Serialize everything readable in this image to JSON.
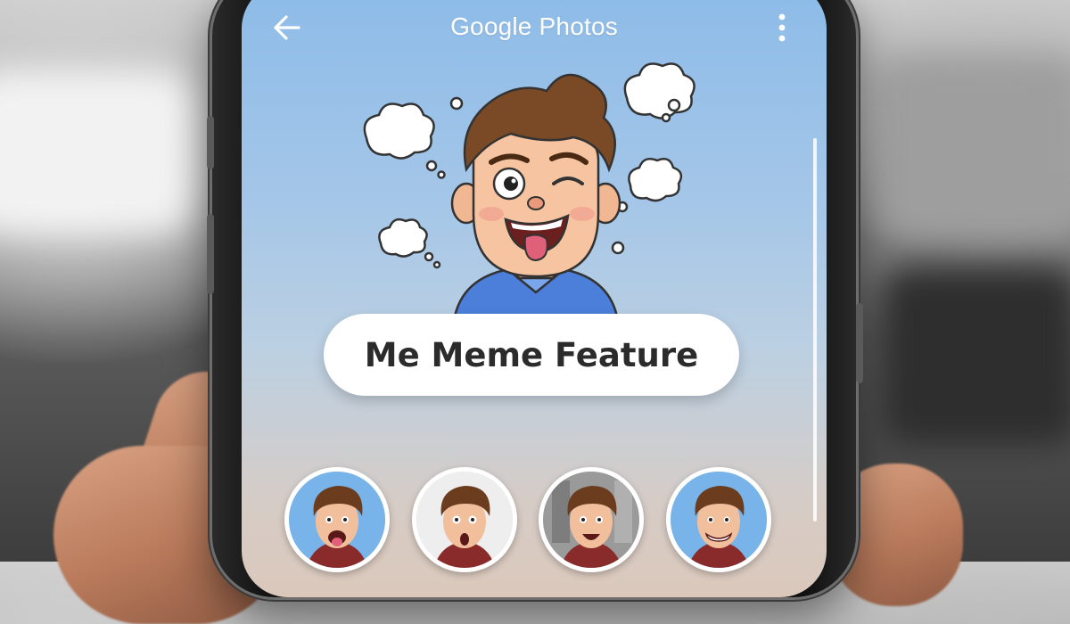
{
  "app": {
    "title": "Google Photos"
  },
  "header": {
    "back_icon": "arrow-left-icon",
    "menu_icon": "more-vert-icon"
  },
  "hero": {
    "feature_label": "Me Meme Feature",
    "illustration": "winking-cartoon-boy-tongue-out"
  },
  "meme_options": [
    {
      "expression": "tongue-out",
      "bg": "#78b4ea"
    },
    {
      "expression": "surprised",
      "bg": "#eeeeee"
    },
    {
      "expression": "excited",
      "bg": "#9a9a9a"
    },
    {
      "expression": "big-smile",
      "bg": "#78b4ea"
    }
  ],
  "colors": {
    "screen_top": "#8cbbe8",
    "screen_bottom": "#dbc8bb",
    "pill_bg": "#ffffff",
    "label_text": "#2b2b2b"
  }
}
